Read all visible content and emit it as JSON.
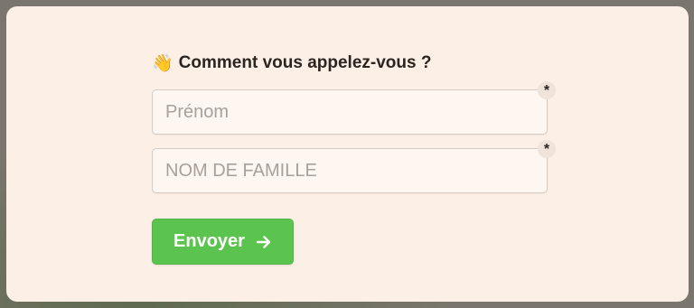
{
  "form": {
    "question_emoji": "👋",
    "question": "Comment vous appelez-vous ?",
    "first_name": {
      "placeholder": "Prénom",
      "value": "",
      "required_mark": "*"
    },
    "last_name": {
      "placeholder": "NOM DE FAMILLE",
      "value": "",
      "required_mark": "*"
    },
    "submit_label": "Envoyer",
    "submit_icon": "arrow-right-icon"
  },
  "colors": {
    "card_background": "#fcefe6",
    "button_green": "#5bc44f",
    "backdrop": "#7a766d"
  }
}
